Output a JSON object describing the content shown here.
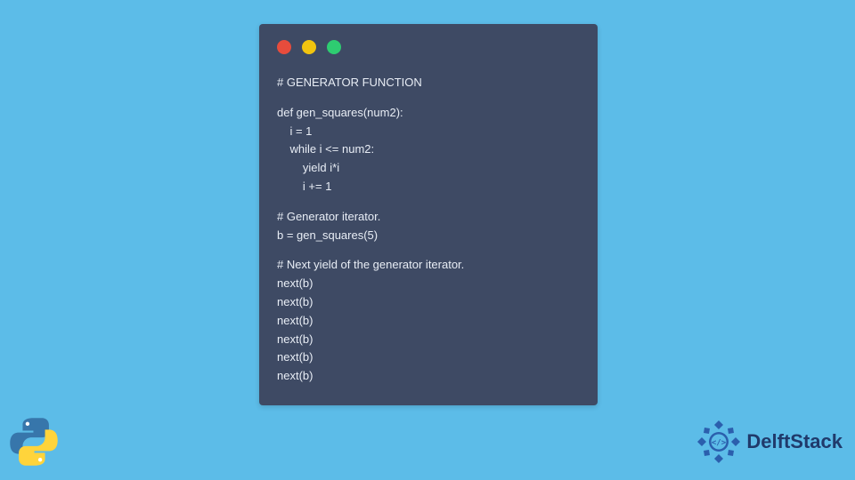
{
  "code": {
    "lines": [
      "# GENERATOR FUNCTION",
      "",
      "def gen_squares(num2):",
      "    i = 1",
      "    while i <= num2:",
      "        yield i*i",
      "        i += 1",
      "",
      "# Generator iterator.",
      "b = gen_squares(5)",
      "",
      "# Next yield of the generator iterator.",
      "next(b)",
      "next(b)",
      "next(b)",
      "next(b)",
      "next(b)",
      "next(b)"
    ]
  },
  "traffic": {
    "colors": {
      "red": "#e74c3c",
      "yellow": "#f1c40f",
      "green": "#2ecc71"
    }
  },
  "brand": {
    "name": "DelftStack"
  },
  "colors": {
    "background": "#5cbce8",
    "card": "#3e4a64",
    "code_text": "#e8edf5",
    "brand_text": "#203a6b"
  }
}
